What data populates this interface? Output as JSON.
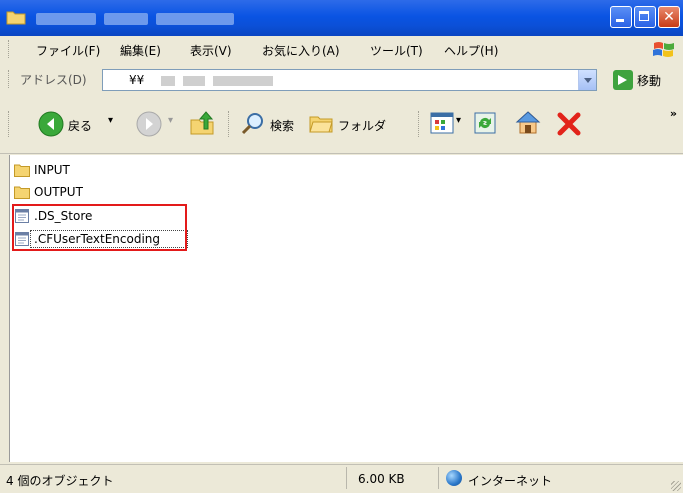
{
  "window": {
    "controls": {
      "minimize": "",
      "maximize": "",
      "close": "✕"
    }
  },
  "menu": {
    "items": [
      "ファイル(F)",
      "編集(E)",
      "表示(V)",
      "お気に入り(A)",
      "ツール(T)",
      "ヘルプ(H)"
    ]
  },
  "address": {
    "label": "アドレス(D)",
    "value": "¥¥",
    "go_label": "移動"
  },
  "toolbar": {
    "back_label": "戻る",
    "search_label": "検索",
    "folders_label": "フォルダ",
    "overflow": "»"
  },
  "files": [
    {
      "name": "INPUT",
      "icon": "folder-icon"
    },
    {
      "name": "OUTPUT",
      "icon": "folder-icon"
    },
    {
      "name": ".DS_Store",
      "icon": "file-icon"
    },
    {
      "name": ".CFUserTextEncoding",
      "icon": "file-icon"
    }
  ],
  "status": {
    "objects": "4 個のオブジェクト",
    "size": "6.00 KB",
    "zone": "インターネット"
  },
  "colors": {
    "title_bar": "#0a54e3",
    "close_button": "#c83b16",
    "highlight_border": "#e31a1a",
    "folder": "#f5d471"
  }
}
